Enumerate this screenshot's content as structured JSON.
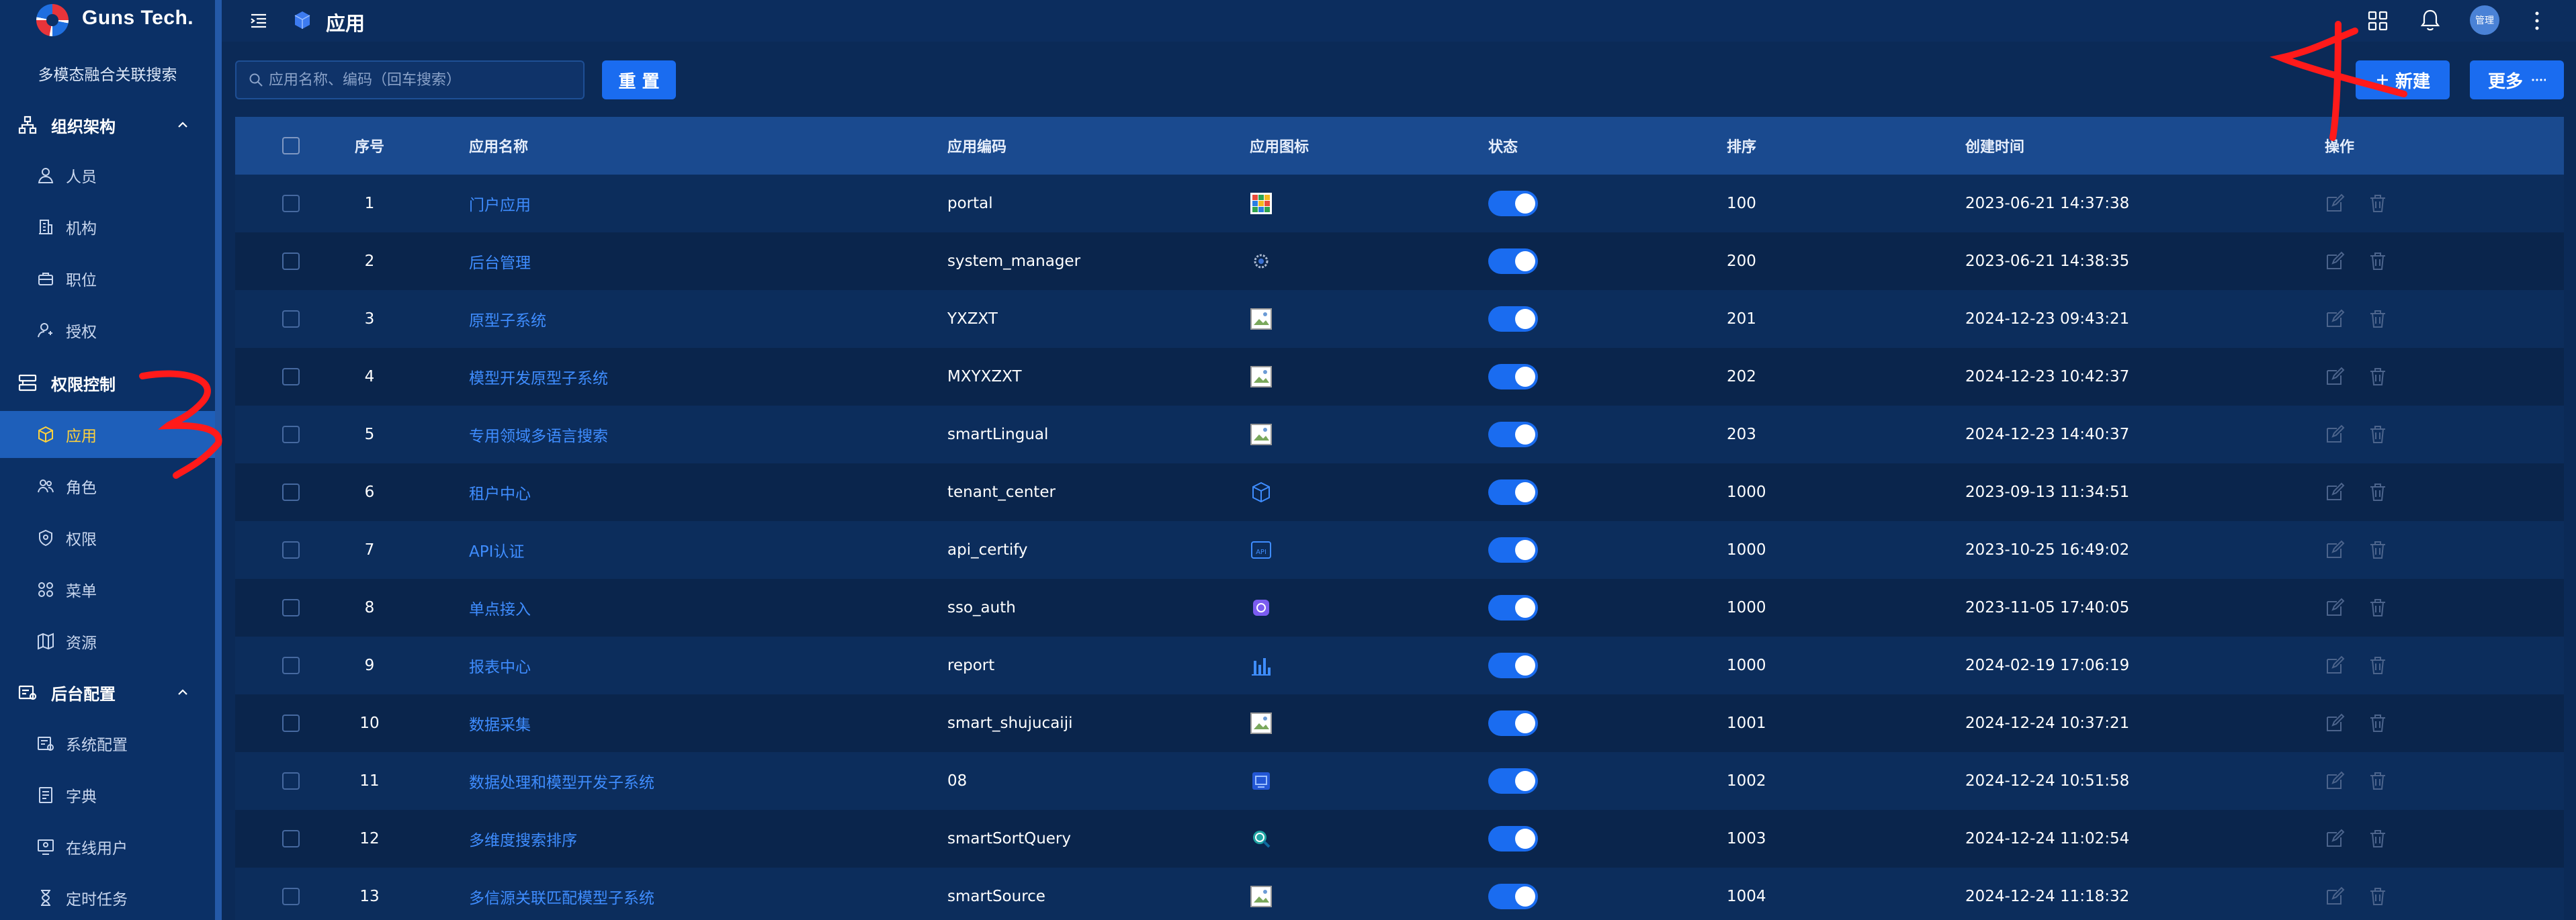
{
  "brand": {
    "name": "Guns Tech."
  },
  "sidebar": {
    "org_name": "多模态融合关联搜索",
    "groups": [
      {
        "label": "组织架构",
        "items": [
          "人员",
          "机构",
          "职位",
          "授权"
        ]
      },
      {
        "label": "权限控制",
        "items": [
          "应用",
          "角色",
          "权限",
          "菜单",
          "资源"
        ]
      },
      {
        "label": "后台配置",
        "items": [
          "系统配置",
          "字典",
          "在线用户",
          "定时任务"
        ]
      }
    ],
    "active_item": "应用"
  },
  "header": {
    "title": "应用",
    "avatar_text": "管理"
  },
  "toolbar": {
    "search_placeholder": "应用名称、编码（回车搜索）",
    "reset_label": "重 置",
    "new_label": "新建",
    "more_label": "更多"
  },
  "table": {
    "columns": [
      "序号",
      "应用名称",
      "应用编码",
      "应用图标",
      "状态",
      "排序",
      "创建时间",
      "操作"
    ],
    "rows": [
      {
        "seq": "1",
        "name": "门户应用",
        "code": "portal",
        "icon": "portal-grid-icon",
        "enabled": true,
        "sort": "100",
        "created": "2023-06-21 14:37:38"
      },
      {
        "seq": "2",
        "name": "后台管理",
        "code": "system_manager",
        "icon": "gear-dot-icon",
        "enabled": true,
        "sort": "200",
        "created": "2023-06-21 14:38:35"
      },
      {
        "seq": "3",
        "name": "原型子系统",
        "code": "YXZXT",
        "icon": "broken-image-icon",
        "enabled": true,
        "sort": "201",
        "created": "2024-12-23 09:43:21"
      },
      {
        "seq": "4",
        "name": "模型开发原型子系统",
        "code": "MXYXZXT",
        "icon": "broken-image-icon",
        "enabled": true,
        "sort": "202",
        "created": "2024-12-23 10:42:37"
      },
      {
        "seq": "5",
        "name": "专用领域多语言搜索",
        "code": "smartLingual",
        "icon": "broken-image-icon",
        "enabled": true,
        "sort": "203",
        "created": "2024-12-23 14:40:37"
      },
      {
        "seq": "6",
        "name": "租户中心",
        "code": "tenant_center",
        "icon": "cube-icon",
        "enabled": true,
        "sort": "1000",
        "created": "2023-09-13 11:34:51"
      },
      {
        "seq": "7",
        "name": "API认证",
        "code": "api_certify",
        "icon": "api-icon",
        "enabled": true,
        "sort": "1000",
        "created": "2023-10-25 16:49:02"
      },
      {
        "seq": "8",
        "name": "单点接入",
        "code": "sso_auth",
        "icon": "sso-icon",
        "enabled": true,
        "sort": "1000",
        "created": "2023-11-05 17:40:05"
      },
      {
        "seq": "9",
        "name": "报表中心",
        "code": "report",
        "icon": "bar-chart-icon",
        "enabled": true,
        "sort": "1000",
        "created": "2024-02-19 17:06:19"
      },
      {
        "seq": "10",
        "name": "数据采集",
        "code": "smart_shujucaiji",
        "icon": "broken-image-icon",
        "enabled": true,
        "sort": "1001",
        "created": "2024-12-24 10:37:21"
      },
      {
        "seq": "11",
        "name": "数据处理和模型开发子系统",
        "code": "08",
        "icon": "model-icon",
        "enabled": true,
        "sort": "1002",
        "created": "2024-12-24 10:51:58"
      },
      {
        "seq": "12",
        "name": "多维度搜索排序",
        "code": "smartSortQuery",
        "icon": "search-globe-icon",
        "enabled": true,
        "sort": "1003",
        "created": "2024-12-24 11:02:54"
      },
      {
        "seq": "13",
        "name": "多信源关联匹配模型子系统",
        "code": "smartSource",
        "icon": "broken-image-icon",
        "enabled": true,
        "sort": "1004",
        "created": "2024-12-24 11:18:32"
      }
    ]
  },
  "colors": {
    "page_bg": "#0b2a57",
    "sidebar_bg": "#0b3066",
    "accent": "#1a6cf0",
    "active_text": "#ffd23c",
    "link": "#3f8dff",
    "annotation": "#ff1a1a"
  },
  "annotations": [
    "3",
    "4"
  ]
}
